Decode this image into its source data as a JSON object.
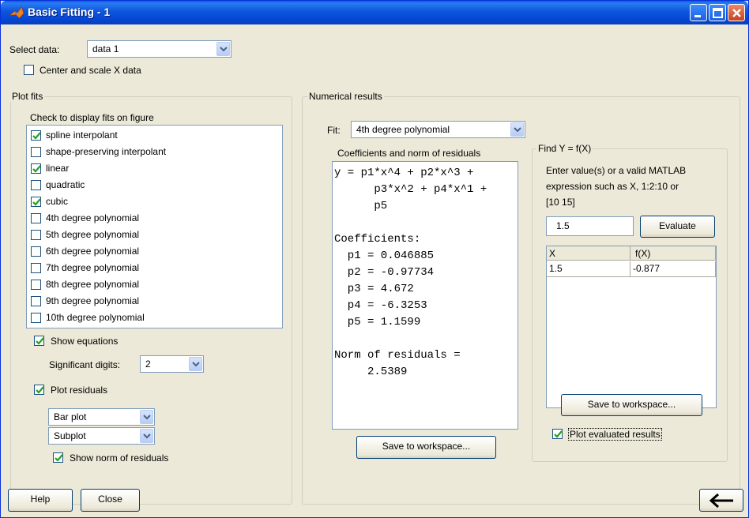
{
  "window": {
    "title": "Basic Fitting - 1"
  },
  "select_data": {
    "label": "Select data:",
    "value": "data 1"
  },
  "center_scale": {
    "label": "Center and scale X data",
    "checked": false
  },
  "plot_fits": {
    "title": "Plot fits",
    "instruction": "Check to display fits on figure",
    "items": [
      {
        "label": "spline interpolant",
        "checked": true
      },
      {
        "label": "shape-preserving interpolant",
        "checked": false
      },
      {
        "label": "linear",
        "checked": true
      },
      {
        "label": "quadratic",
        "checked": false
      },
      {
        "label": "cubic",
        "checked": true
      },
      {
        "label": "4th degree polynomial",
        "checked": false
      },
      {
        "label": "5th degree polynomial",
        "checked": false
      },
      {
        "label": "6th degree polynomial",
        "checked": false
      },
      {
        "label": "7th degree polynomial",
        "checked": false
      },
      {
        "label": "8th degree polynomial",
        "checked": false
      },
      {
        "label": "9th degree polynomial",
        "checked": false
      },
      {
        "label": "10th degree polynomial",
        "checked": false
      }
    ],
    "show_equations": {
      "label": "Show equations",
      "checked": true
    },
    "significant_digits": {
      "label": "Significant digits:",
      "value": "2"
    },
    "plot_residuals": {
      "label": "Plot residuals",
      "checked": true
    },
    "residual_plot_type": "Bar plot",
    "residual_plot_location": "Subplot",
    "show_norm": {
      "label": "Show norm of residuals",
      "checked": true
    }
  },
  "numerical_results": {
    "title": "Numerical results",
    "fit_label": "Fit:",
    "fit_value": "4th degree polynomial",
    "coeff_title": "Coefficients and norm of residuals",
    "coeff_lines": [
      "y = p1*x^4 + p2*x^3 +",
      "      p3*x^2 + p4*x^1 +",
      "      p5",
      "",
      "Coefficients:",
      "  p1 = 0.046885",
      "  p2 = -0.97734",
      "  p3 = 4.672",
      "  p4 = -6.3253",
      "  p5 = 1.1599",
      "",
      "Norm of residuals =",
      "     2.5389"
    ],
    "save_button": "Save to workspace..."
  },
  "find_y": {
    "title": "Find Y = f(X)",
    "instructions": [
      "Enter value(s) or a valid MATLAB",
      "expression such as X, 1:2:10 or",
      "[10 15]"
    ],
    "input_value": "1.5",
    "evaluate_button": "Evaluate",
    "table_headers": [
      "X",
      "f(X)"
    ],
    "table_rows": [
      [
        "1.5",
        "-0.877"
      ]
    ],
    "save_button": "Save to workspace...",
    "plot_evaluated": {
      "label": "Plot evaluated results",
      "checked": true
    }
  },
  "footer": {
    "help": "Help",
    "close": "Close",
    "back_icon": "arrow-left-icon"
  },
  "colors": {
    "titlebar": "#0054e3",
    "check": "#21a121",
    "face": "#ece9d8"
  }
}
